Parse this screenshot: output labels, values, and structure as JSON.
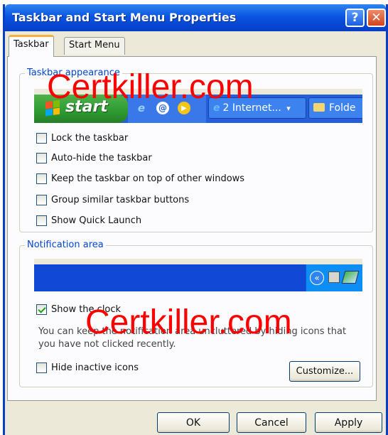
{
  "window": {
    "title": "Taskbar and Start Menu Properties",
    "help_label": "?",
    "close_label": "✕"
  },
  "tabs": [
    {
      "label": "Taskbar",
      "active": true
    },
    {
      "label": "Start Menu",
      "active": false
    }
  ],
  "appearance": {
    "legend": "Taskbar appearance",
    "start_label": "start",
    "task_buttons": [
      "2 Internet...",
      "Folde"
    ],
    "task_button_chevron": "▾",
    "options": [
      {
        "label": "Lock the taskbar",
        "checked": false
      },
      {
        "label": "Auto-hide the taskbar",
        "checked": false
      },
      {
        "label": "Keep the taskbar on top of other windows",
        "checked": false
      },
      {
        "label": "Group similar taskbar buttons",
        "checked": false
      },
      {
        "label": "Show Quick Launch",
        "checked": false
      }
    ]
  },
  "notification": {
    "legend": "Notification area",
    "tray_chevron": "«",
    "show_clock": {
      "label": "Show the clock",
      "checked": true
    },
    "description": "You can keep the notification area uncluttered by hiding icons that you have not clicked recently.",
    "hide_inactive": {
      "label": "Hide inactive icons",
      "checked": false
    },
    "customize_label": "Customize..."
  },
  "buttons": {
    "ok": "OK",
    "cancel": "Cancel",
    "apply": "Apply"
  },
  "watermark": "Certkiller.com",
  "colors": {
    "titlebar": "#0b55e0",
    "dialog_bg": "#ece9d8",
    "legend_text": "#0046d5",
    "watermark": "#ff0000"
  }
}
